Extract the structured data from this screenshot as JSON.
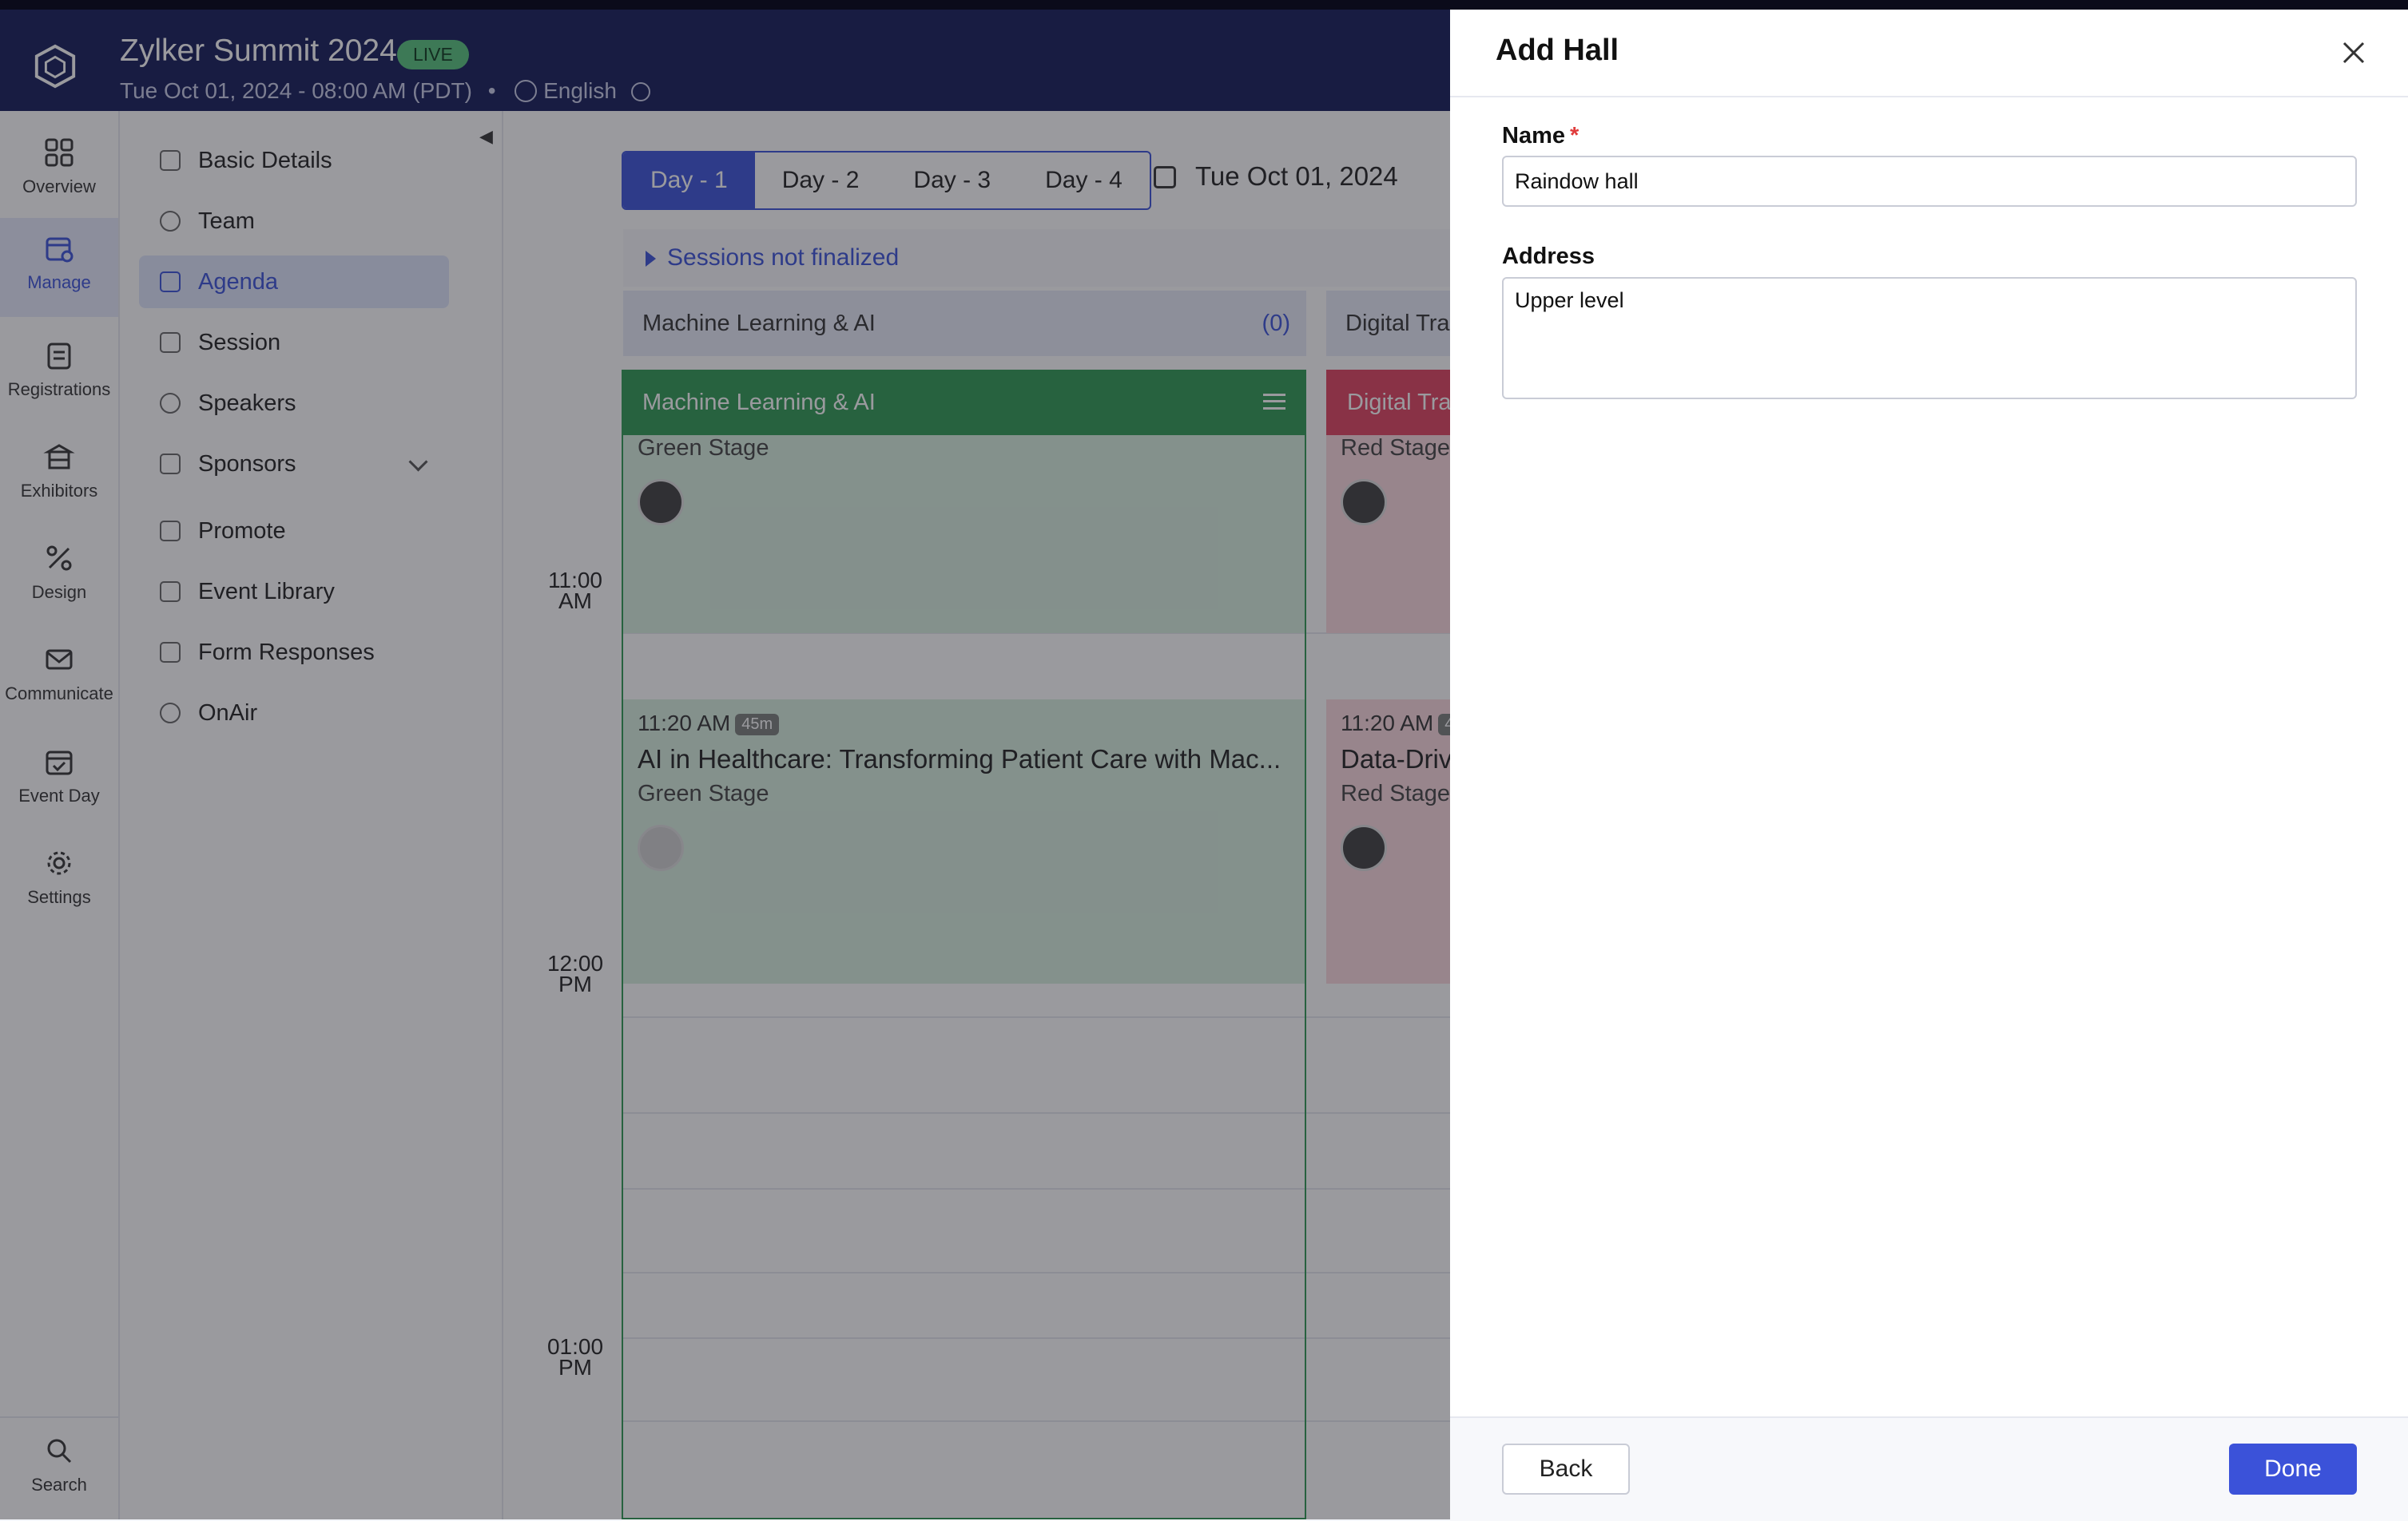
{
  "event": {
    "title": "Zylker Summit 2024",
    "status_badge": "LIVE",
    "datetime": "Tue Oct 01, 2024 - 08:00 AM (PDT)",
    "separator": "•",
    "language": "English"
  },
  "rail": {
    "items": [
      {
        "label": "Overview",
        "icon": "grid-icon"
      },
      {
        "label": "Manage",
        "icon": "calendar-gear-icon",
        "active": true
      },
      {
        "label": "Registrations",
        "icon": "clipboard-icon"
      },
      {
        "label": "Exhibitors",
        "icon": "booth-icon"
      },
      {
        "label": "Design",
        "icon": "design-icon"
      },
      {
        "label": "Communicate",
        "icon": "mail-icon"
      },
      {
        "label": "Event Day",
        "icon": "calendar-check-icon"
      },
      {
        "label": "Settings",
        "icon": "gear-icon"
      }
    ],
    "search_label": "Search"
  },
  "sidebar": {
    "items": [
      {
        "label": "Basic Details"
      },
      {
        "label": "Team"
      },
      {
        "label": "Agenda",
        "active": true
      },
      {
        "label": "Session"
      },
      {
        "label": "Speakers"
      },
      {
        "label": "Sponsors",
        "expandable": true
      },
      {
        "label": "Promote"
      },
      {
        "label": "Event Library"
      },
      {
        "label": "Form Responses"
      },
      {
        "label": "OnAir"
      }
    ]
  },
  "agenda": {
    "days": [
      "Day - 1",
      "Day - 2",
      "Day - 3",
      "Day - 4"
    ],
    "active_day": "Day - 1",
    "date": "Tue Oct 01, 2024",
    "sessions_not_finalized": "Sessions not finalized",
    "tracks": [
      {
        "name": "Machine Learning & AI",
        "count": "(0)",
        "color": "#2e9a52"
      },
      {
        "name": "Digital Tra",
        "color": "#e0425f"
      }
    ],
    "time_labels": [
      {
        "time": "11:00",
        "period": "AM"
      },
      {
        "time": "12:00",
        "period": "PM"
      },
      {
        "time": "01:00",
        "period": "PM"
      }
    ],
    "cards": [
      {
        "stage": "Green Stage"
      },
      {
        "time": "11:20 AM",
        "duration": "45m",
        "title": "AI in Healthcare: Transforming Patient Care with Mac...",
        "stage": "Green Stage"
      },
      {
        "stage": "Red Stage"
      },
      {
        "time": "11:20 AM",
        "duration": "4",
        "title": "Data-Driv",
        "stage": "Red Stage"
      }
    ]
  },
  "drawer": {
    "title": "Add Hall",
    "name_label": "Name",
    "required_mark": "*",
    "name_value": "Raindow hall",
    "address_label": "Address",
    "address_value": "Upper level",
    "back_label": "Back",
    "done_label": "Done"
  },
  "colors": {
    "header_bg": "#131a58",
    "accent": "#3b52d9",
    "green_track": "#2e9a52",
    "red_track": "#e0425f",
    "live_badge": "#56c47c"
  }
}
